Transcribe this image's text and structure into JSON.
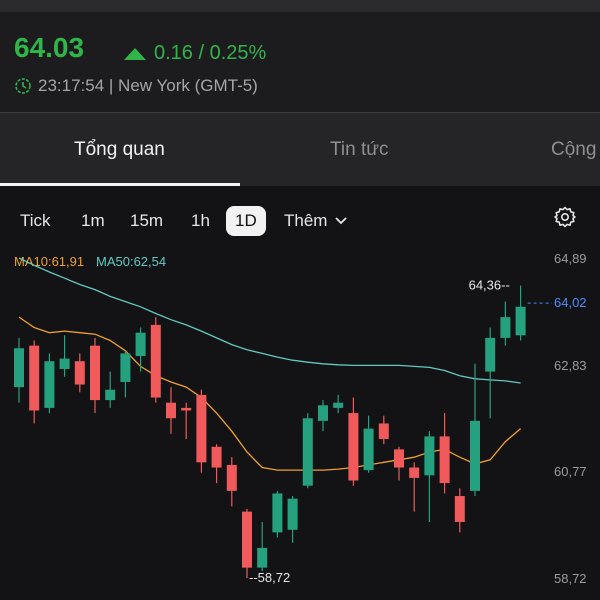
{
  "quote": {
    "price": "64.03",
    "change": "0.16 / 0.25%",
    "time_text": "23:17:54 | New York (GMT-5)"
  },
  "tabs": [
    "Tổng quan",
    "Tin tức",
    "Cộng"
  ],
  "periods": [
    "Tick",
    "1m",
    "15m",
    "1h",
    "1D"
  ],
  "more_label": "Thêm",
  "selected_period": "1D",
  "indicators": {
    "ma10": "MA10:61,91",
    "ma50": "MA50:62,54"
  },
  "colors": {
    "up": "#26a17f",
    "down": "#f05a5a",
    "price_green": "#2fb54a",
    "ma10": "#f0a030",
    "ma50": "#63c9c0"
  },
  "chart_data": {
    "type": "candlestick",
    "y_ticks": [
      "64,89",
      "62,83",
      "60,77",
      "58,72"
    ],
    "y_range": [
      58.72,
      64.89
    ],
    "current_price_label": "64,02",
    "high_label": "64,36",
    "low_label": "58,72",
    "candles": [
      {
        "o": 62.4,
        "c": 63.15,
        "h": 63.35,
        "l": 62.1
      },
      {
        "o": 63.2,
        "c": 61.95,
        "h": 63.3,
        "l": 61.7
      },
      {
        "o": 62.0,
        "c": 62.9,
        "h": 63.05,
        "l": 61.9
      },
      {
        "o": 62.75,
        "c": 62.95,
        "h": 63.4,
        "l": 62.6
      },
      {
        "o": 62.9,
        "c": 62.45,
        "h": 63.05,
        "l": 62.3
      },
      {
        "o": 63.2,
        "c": 62.15,
        "h": 63.35,
        "l": 61.9
      },
      {
        "o": 62.15,
        "c": 62.35,
        "h": 62.7,
        "l": 62.0
      },
      {
        "o": 62.5,
        "c": 63.05,
        "h": 63.1,
        "l": 62.2
      },
      {
        "o": 63.0,
        "c": 63.45,
        "h": 63.55,
        "l": 62.7
      },
      {
        "o": 63.6,
        "c": 62.2,
        "h": 63.75,
        "l": 62.1
      },
      {
        "o": 62.1,
        "c": 61.8,
        "h": 62.4,
        "l": 61.5
      },
      {
        "o": 62.0,
        "c": 61.95,
        "h": 62.1,
        "l": 61.4
      },
      {
        "o": 62.25,
        "c": 60.95,
        "h": 62.35,
        "l": 60.75
      },
      {
        "o": 61.25,
        "c": 60.85,
        "h": 61.3,
        "l": 60.55
      },
      {
        "o": 60.9,
        "c": 60.4,
        "h": 61.05,
        "l": 60.1
      },
      {
        "o": 60.0,
        "c": 58.92,
        "h": 60.05,
        "l": 58.72
      },
      {
        "o": 58.92,
        "c": 59.3,
        "h": 59.8,
        "l": 58.85
      },
      {
        "o": 59.6,
        "c": 60.35,
        "h": 60.4,
        "l": 59.5
      },
      {
        "o": 59.65,
        "c": 60.25,
        "h": 60.3,
        "l": 59.4
      },
      {
        "o": 60.5,
        "c": 61.8,
        "h": 61.9,
        "l": 60.45
      },
      {
        "o": 61.75,
        "c": 62.05,
        "h": 62.15,
        "l": 61.55
      },
      {
        "o": 62.0,
        "c": 62.1,
        "h": 62.25,
        "l": 61.9
      },
      {
        "o": 61.9,
        "c": 60.6,
        "h": 62.2,
        "l": 60.5
      },
      {
        "o": 60.8,
        "c": 61.6,
        "h": 61.85,
        "l": 60.75
      },
      {
        "o": 61.7,
        "c": 61.4,
        "h": 61.85,
        "l": 61.3
      },
      {
        "o": 61.2,
        "c": 60.85,
        "h": 61.25,
        "l": 60.6
      },
      {
        "o": 60.85,
        "c": 60.65,
        "h": 60.95,
        "l": 60.0
      },
      {
        "o": 60.7,
        "c": 61.45,
        "h": 61.55,
        "l": 59.8
      },
      {
        "o": 61.45,
        "c": 60.55,
        "h": 61.9,
        "l": 60.35
      },
      {
        "o": 60.3,
        "c": 59.8,
        "h": 60.45,
        "l": 59.6
      },
      {
        "o": 60.4,
        "c": 61.75,
        "h": 62.85,
        "l": 60.3
      },
      {
        "o": 62.7,
        "c": 63.35,
        "h": 63.55,
        "l": 61.8
      },
      {
        "o": 63.35,
        "c": 63.75,
        "h": 64.05,
        "l": 63.2
      },
      {
        "o": 63.4,
        "c": 63.95,
        "h": 64.36,
        "l": 63.3
      }
    ],
    "ma10": [
      63.75,
      63.55,
      63.45,
      63.48,
      63.45,
      63.42,
      63.3,
      63.1,
      62.8,
      62.62,
      62.5,
      62.4,
      62.2,
      61.9,
      61.55,
      61.15,
      60.85,
      60.8,
      60.8,
      60.8,
      60.8,
      60.82,
      60.85,
      60.9,
      60.95,
      61.0,
      61.05,
      61.15,
      61.2,
      61.05,
      60.92,
      61.0,
      61.35,
      61.6
    ],
    "ma50": [
      64.89,
      64.75,
      64.62,
      64.5,
      64.38,
      64.28,
      64.15,
      64.05,
      63.95,
      63.82,
      63.7,
      63.6,
      63.48,
      63.35,
      63.22,
      63.12,
      63.05,
      62.98,
      62.92,
      62.88,
      62.85,
      62.83,
      62.82,
      62.82,
      62.82,
      62.82,
      62.8,
      62.78,
      62.72,
      62.62,
      62.56,
      62.54,
      62.52,
      62.48
    ]
  }
}
